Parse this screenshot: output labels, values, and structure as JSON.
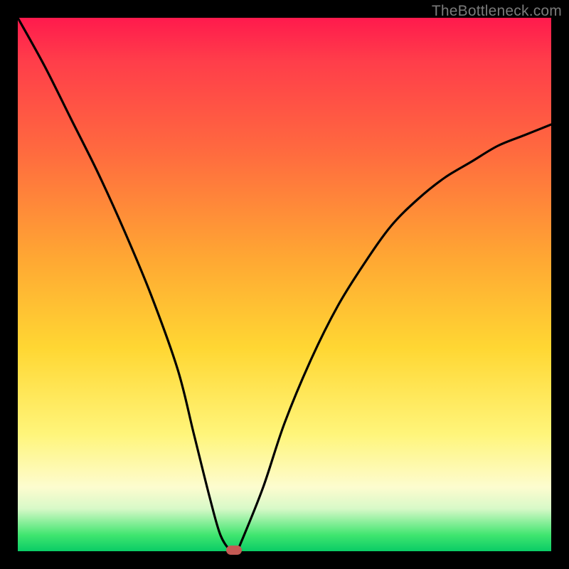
{
  "watermark": "TheBottleneck.com",
  "chart_data": {
    "type": "line",
    "title": "",
    "xlabel": "",
    "ylabel": "",
    "xlim": [
      0,
      100
    ],
    "ylim": [
      0,
      100
    ],
    "grid": false,
    "legend": false,
    "series": [
      {
        "name": "bottleneck-curve",
        "x": [
          0,
          5,
          10,
          15,
          20,
          25,
          30,
          33,
          36,
          38,
          40,
          41,
          42,
          46,
          50,
          55,
          60,
          65,
          70,
          75,
          80,
          85,
          90,
          95,
          100
        ],
        "y": [
          100,
          91,
          81,
          71,
          60,
          48,
          34,
          22,
          10,
          3,
          0,
          0,
          2,
          12,
          24,
          36,
          46,
          54,
          61,
          66,
          70,
          73,
          76,
          78,
          80
        ]
      }
    ],
    "marker": {
      "x": 40.5,
      "y": 0
    },
    "gradient_colors": {
      "top": "#ff1a4d",
      "mid_upper": "#ffa733",
      "mid": "#fff57a",
      "bottom": "#0acc66"
    }
  }
}
